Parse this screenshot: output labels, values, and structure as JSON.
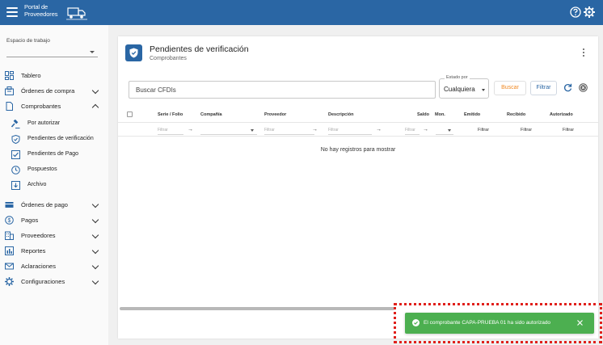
{
  "header": {
    "logo_line1": "Portal de",
    "logo_line2": "Proveedores",
    "colors": {
      "primary": "#2a66a4",
      "success": "#4caf50",
      "accent": "#f08a24"
    }
  },
  "sidebar": {
    "workspace_label": "Espacio de trabajo",
    "items": [
      {
        "label": "Tablero",
        "icon": "dashboard-icon"
      },
      {
        "label": "Órdenes de compra",
        "icon": "orders-icon",
        "expand": "collapsed"
      },
      {
        "label": "Comprobantes",
        "icon": "document-icon",
        "expand": "expanded"
      },
      {
        "label": "Órdenes de pago",
        "icon": "payment-order-icon",
        "expand": "collapsed"
      },
      {
        "label": "Pagos",
        "icon": "dollar-icon",
        "expand": "collapsed"
      },
      {
        "label": "Proveedores",
        "icon": "building-icon",
        "expand": "collapsed"
      },
      {
        "label": "Reportes",
        "icon": "chart-icon",
        "expand": "collapsed"
      },
      {
        "label": "Aclaraciones",
        "icon": "mail-icon",
        "expand": "collapsed"
      },
      {
        "label": "Configuraciones",
        "icon": "gear-icon",
        "expand": "collapsed"
      }
    ],
    "subitems": [
      {
        "label": "Por autorizar",
        "icon": "gavel-icon"
      },
      {
        "label": "Pendientes de verificación",
        "icon": "shield-icon"
      },
      {
        "label": "Pendientes de Pago",
        "icon": "checklist-icon"
      },
      {
        "label": "Pospuestos",
        "icon": "clock-icon"
      },
      {
        "label": "Archivo",
        "icon": "archive-icon"
      }
    ]
  },
  "main": {
    "title": "Pendientes de verificación",
    "subtitle": "Comprobantes",
    "search_placeholder": "Buscar CFDIs",
    "estado_label": "Estado por",
    "estado_value": "Cualquiera",
    "buscar_label": "Buscar",
    "filtrar_label": "Filtrar",
    "columns": [
      "Serie / Folio",
      "Compañía",
      "Proveedor",
      "Descripción",
      "Saldo",
      "Mon.",
      "Emitido",
      "Recibido",
      "Autorizado"
    ],
    "filter_placeholder": "Filtrar",
    "filter_button": "Filtrar",
    "empty_message": "No hay registros para mostrar"
  },
  "toast": {
    "message": "El comprobante CAPA-PRUEBA 01 ha sido autorizado"
  }
}
